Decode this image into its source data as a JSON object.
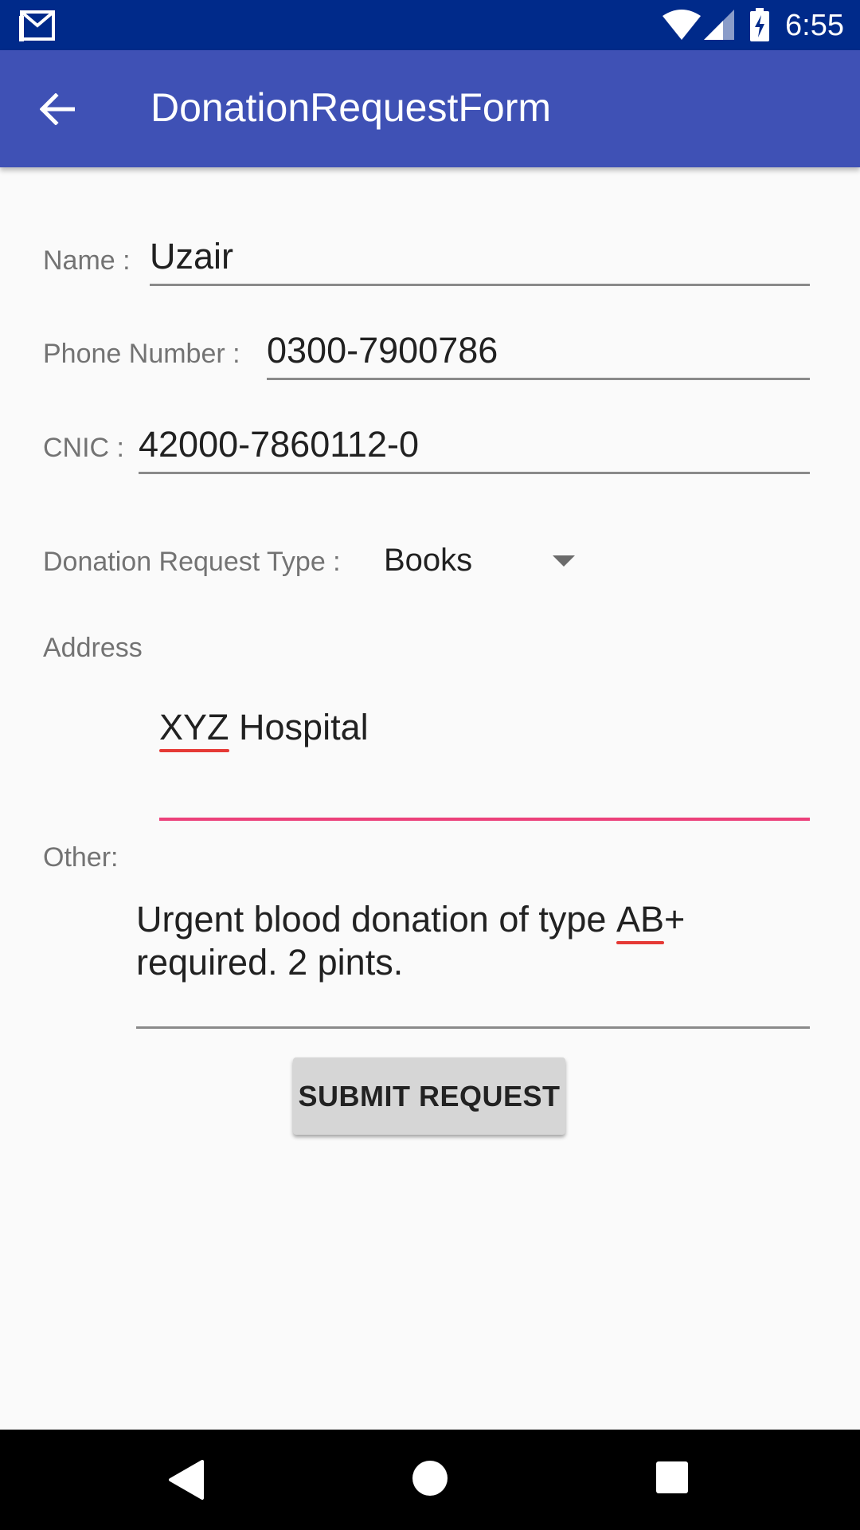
{
  "status_bar": {
    "time": "6:55",
    "icons": [
      "gmail-icon",
      "wifi-icon",
      "signal-icon",
      "battery-charging-icon"
    ]
  },
  "app_bar": {
    "title": "DonationRequestForm",
    "back_icon": "arrow-back-icon"
  },
  "form": {
    "name": {
      "label": "Name :",
      "value": "Uzair"
    },
    "phone": {
      "label": "Phone Number :",
      "value": "0300-7900786"
    },
    "cnic": {
      "label": "CNIC :",
      "value": "42000-7860112-0"
    },
    "request_type": {
      "label": "Donation Request Type :",
      "value": "Books"
    },
    "address": {
      "label": "Address",
      "value_flagged": "XYZ",
      "value_rest": " Hospital"
    },
    "other": {
      "label": "Other:",
      "line1_before": "Urgent blood donation of type ",
      "line1_flagged": "AB",
      "line1_after": "+",
      "line2": "required. 2 pints."
    },
    "submit_label": "SUBMIT REQUEST"
  },
  "colors": {
    "status_bar": "#002a8a",
    "app_bar": "#3f51b5",
    "accent": "#ec407a",
    "background": "#fafafa"
  },
  "nav_bar": {
    "icons": [
      "back-triangle-icon",
      "home-circle-icon",
      "recents-square-icon"
    ]
  }
}
